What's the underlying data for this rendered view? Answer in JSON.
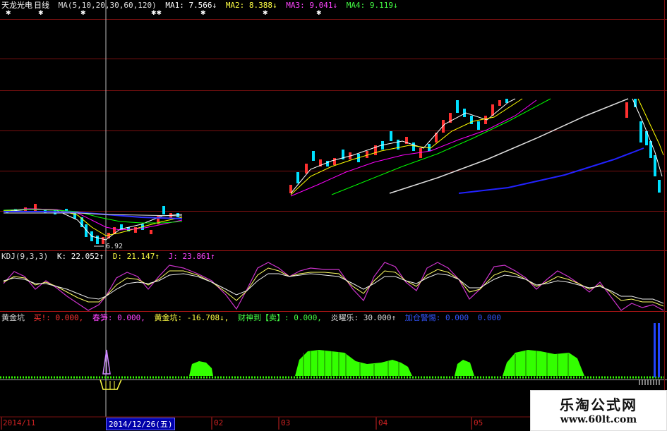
{
  "main_panel": {
    "name": "天龙光电",
    "period": "日线",
    "ma_label": "MA(5,10,20,30,60,120)",
    "ma1": "MA1: 7.566↓",
    "ma2": "MA2: 8.388↓",
    "ma3": "MA3: 9.041↓",
    "ma4": "MA4: 9.119↓",
    "low_label": "6.92"
  },
  "kdj_panel": {
    "label": "KDJ(9,3,3)",
    "k": "K: 22.052↑",
    "d": "D: 21.147↑",
    "j": "J: 23.861↑"
  },
  "gold_panel": {
    "label": "黄金坑",
    "buy": "买!: 0.000,",
    "spring": "春笋: 0.000,",
    "gold": "黄金坑: -16.708↓,",
    "caishen": "财神到【卖】: 0.000,",
    "yan": "炎曜乐: 30.000↑",
    "extra": "加仓警惕: 0.000",
    "extra_val": "0.000"
  },
  "date_axis": {
    "ticks": [
      "2014/11",
      "02",
      "03",
      "04",
      "05"
    ],
    "cursor": "2014/12/26(五)"
  },
  "watermark": {
    "cn": "乐淘公式网",
    "url": "www.60lt.com"
  },
  "colors": {
    "grid": "#7a1010",
    "up": "#ff3030",
    "down": "#00e0ff",
    "ma1": "#ffffff",
    "ma2": "#ffff00",
    "ma3": "#ff00ff",
    "ma4": "#00ff00",
    "ma5": "#2020ff",
    "ma6": "#e0e0e0",
    "gold_fill": "#33ff00"
  }
}
